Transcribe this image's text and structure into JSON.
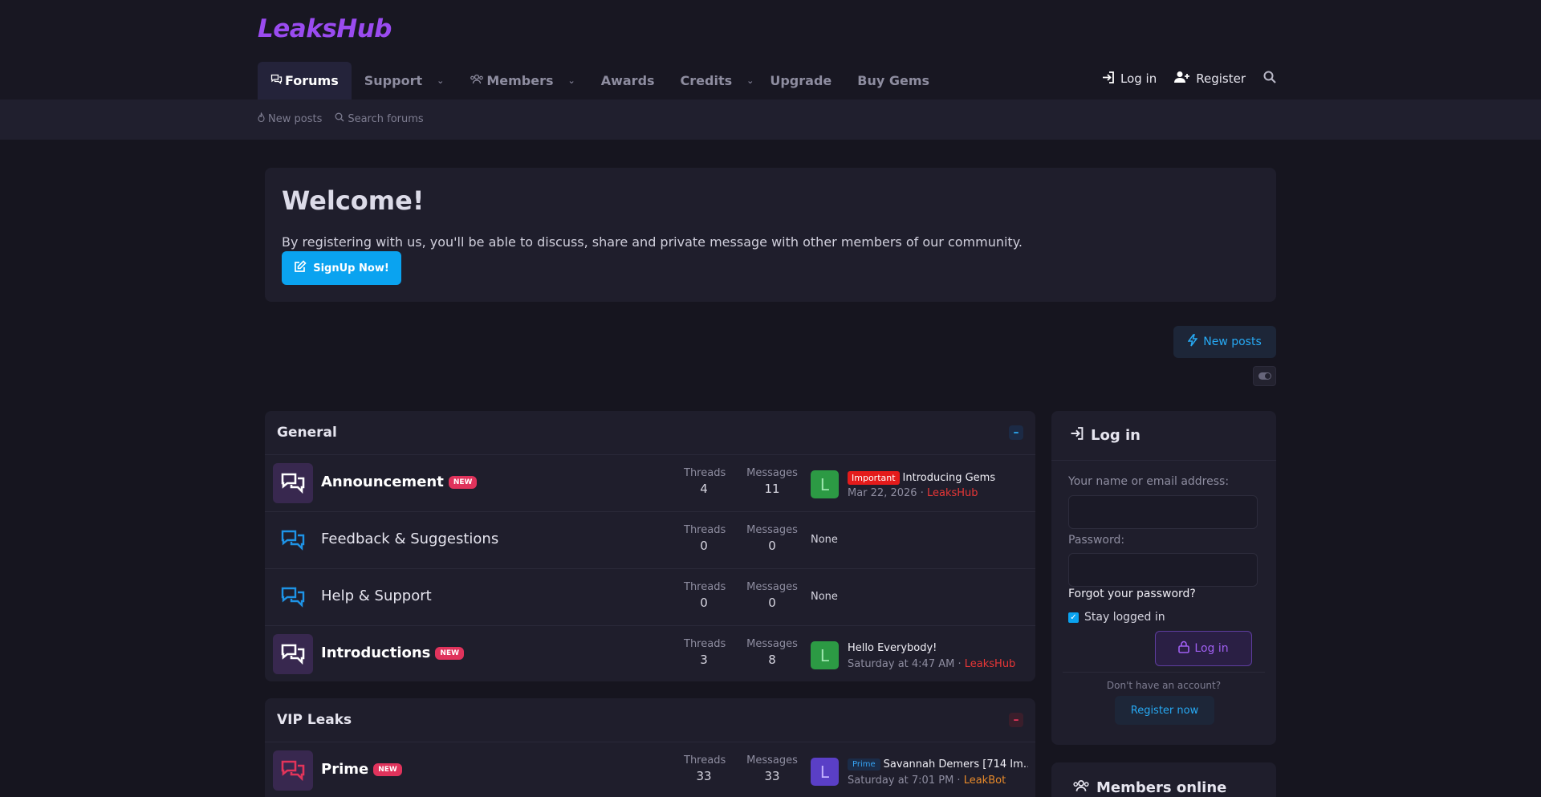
{
  "brand": {
    "logo": "LeaksHub"
  },
  "nav": {
    "items": [
      {
        "label": "Forums",
        "active": true,
        "icon": "comments-icon",
        "dropdown": false
      },
      {
        "label": "Support",
        "active": false,
        "dropdown": true
      },
      {
        "label": "Members",
        "active": false,
        "icon": "users-icon",
        "dropdown": true
      },
      {
        "label": "Awards",
        "active": false,
        "dropdown": false
      },
      {
        "label": "Credits",
        "active": false,
        "dropdown": true
      },
      {
        "label": "Upgrade",
        "active": false,
        "dropdown": false
      },
      {
        "label": "Buy Gems",
        "active": false,
        "dropdown": false
      }
    ],
    "login": "Log in",
    "register": "Register"
  },
  "subnav": {
    "new_posts": "New posts",
    "search_forums": "Search forums"
  },
  "welcome": {
    "title": "Welcome!",
    "text": "By registering with us, you'll be able to discuss, share and private message with other members of our community.",
    "signup": "SignUp Now!"
  },
  "actions": {
    "new_posts": "New posts"
  },
  "categories": [
    {
      "title": "General",
      "forums": [
        {
          "name": "Announcement",
          "new": true,
          "unread": true,
          "threads_label": "Threads",
          "threads": "4",
          "messages_label": "Messages",
          "messages": "11",
          "last_avatar": "L",
          "last_prefix": "Important",
          "last_title": "Introducing Gems",
          "last_date": "Mar 22, 2026",
          "last_user": "LeaksHub"
        },
        {
          "name": "Feedback & Suggestions",
          "new": false,
          "unread": false,
          "threads_label": "Threads",
          "threads": "0",
          "messages_label": "Messages",
          "messages": "0",
          "last_none": "None"
        },
        {
          "name": "Help & Support",
          "new": false,
          "unread": false,
          "threads_label": "Threads",
          "threads": "0",
          "messages_label": "Messages",
          "messages": "0",
          "last_none": "None"
        },
        {
          "name": "Introductions",
          "new": true,
          "unread": true,
          "threads_label": "Threads",
          "threads": "3",
          "messages_label": "Messages",
          "messages": "8",
          "last_avatar": "L",
          "last_title": "Hello Everybody!",
          "last_date": "Saturday at 4:47 AM",
          "last_user": "LeaksHub"
        }
      ]
    },
    {
      "title": "VIP Leaks",
      "forums": [
        {
          "name": "Prime",
          "new": true,
          "unread": true,
          "threads_label": "Threads",
          "threads": "33",
          "messages_label": "Messages",
          "messages": "33",
          "last_avatar": "L",
          "last_prefix": "Prime",
          "last_title": "Savannah Demers [714 Im…",
          "last_date": "Saturday at 7:01 PM",
          "last_user": "LeakBot"
        }
      ]
    }
  ],
  "badge_new": "NEW",
  "login_box": {
    "title": "Log in",
    "name_label": "Your name or email address:",
    "password_label": "Password:",
    "forgot": "Forgot your password?",
    "stay": "Stay logged in",
    "button": "Log in",
    "no_account": "Don't have an account?",
    "register": "Register now"
  },
  "members_online": {
    "title": "Members online"
  },
  "colors": {
    "accent_purple": "#9a4bf0",
    "accent_blue": "#0aa3f0",
    "badge_red": "#e0335c"
  }
}
